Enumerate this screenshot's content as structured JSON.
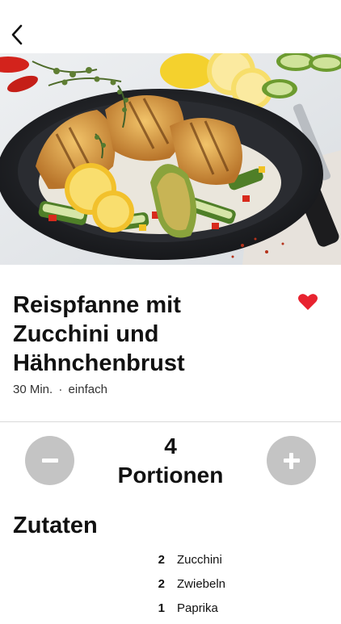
{
  "header": {
    "back_icon": "chevron-left-icon"
  },
  "hero": {
    "image_description_icon": "food-photo"
  },
  "recipe": {
    "title": "Reispfanne mit\nZucchini und\nHähnchenbrust",
    "duration": "30 Min.",
    "separator": "·",
    "difficulty": "einfach",
    "favorite": true,
    "favorite_color": "#e8232f"
  },
  "portions": {
    "count": "4",
    "label": "Portionen",
    "decrease_icon": "minus-icon",
    "increase_icon": "plus-icon",
    "button_color": "#c4c4c4"
  },
  "ingredients": {
    "title": "Zutaten",
    "items": [
      {
        "qty": "2",
        "name": "Zucchini"
      },
      {
        "qty": "2",
        "name": "Zwiebeln"
      },
      {
        "qty": "1",
        "name": "Paprika"
      }
    ]
  }
}
